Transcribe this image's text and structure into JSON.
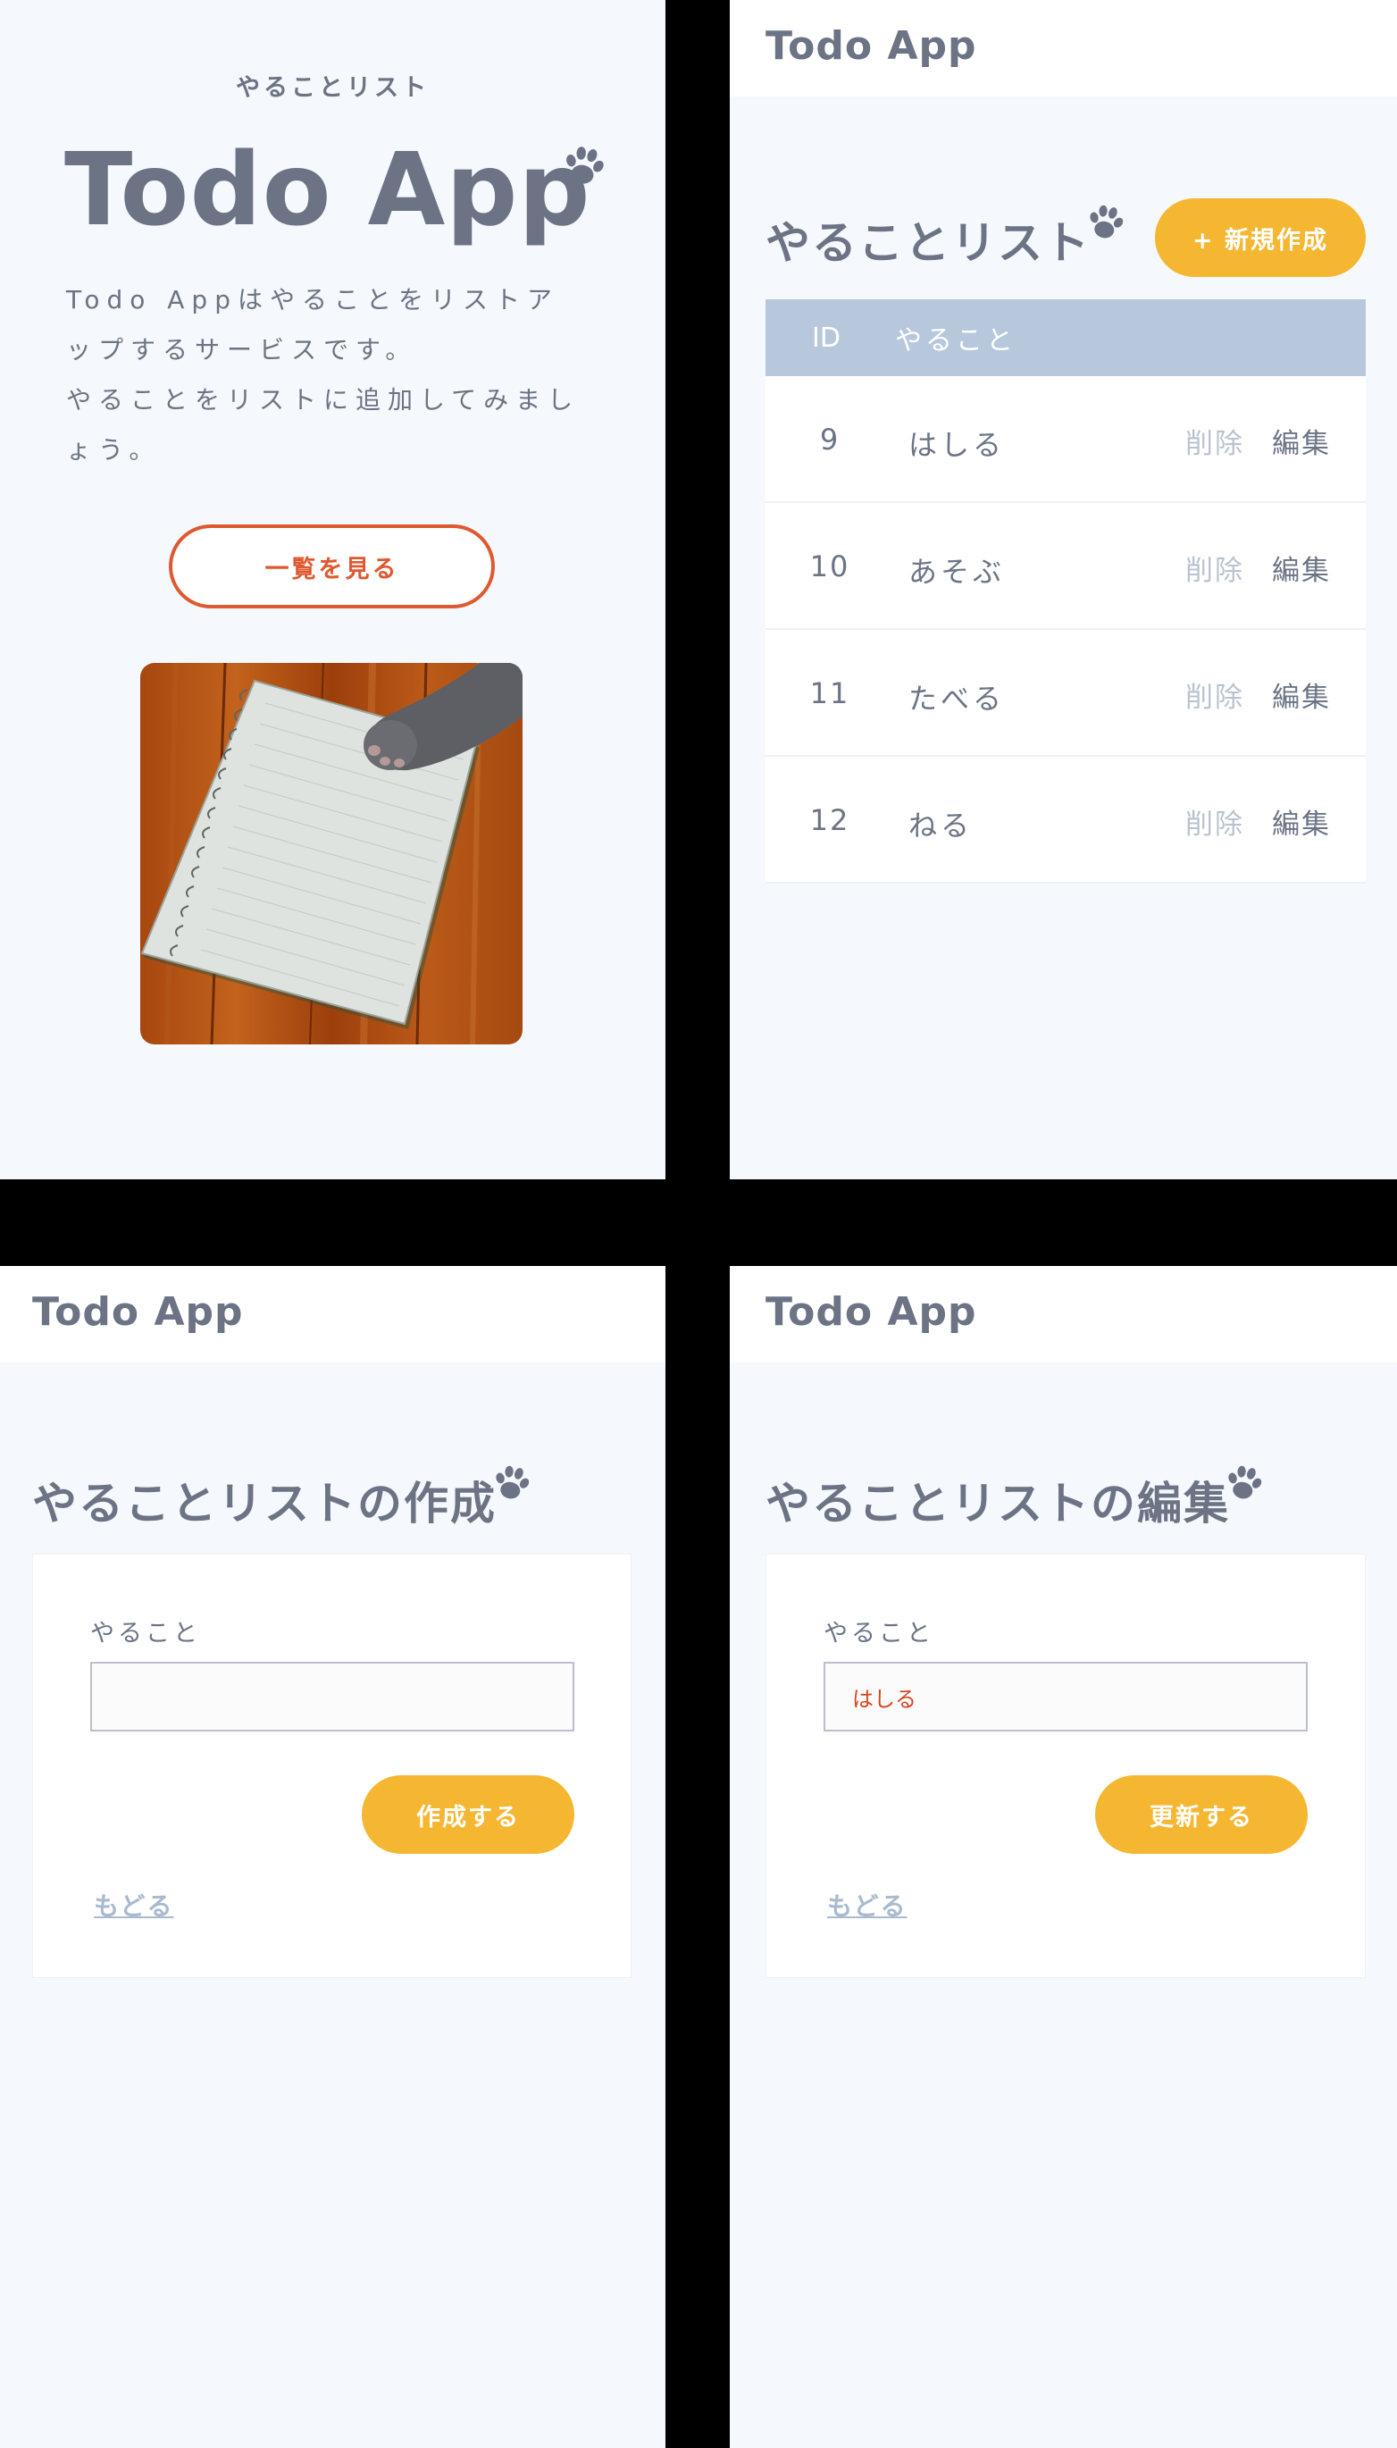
{
  "top_page": {
    "subtitle": "やることリスト",
    "title": "Todo App",
    "description_line1": "Todo Appはやることをリストア",
    "description_line2": "ップするサービスです。",
    "description_line3": "やることをリストに追加してみまし",
    "description_line4": "ょう。",
    "view_list_button": "一覧を見る"
  },
  "list_page": {
    "header_title": "Todo App",
    "page_title": "やることリスト",
    "new_button": "+ 新規作成",
    "table": {
      "columns": [
        "ID",
        "やること"
      ],
      "rows": [
        {
          "id": "9",
          "todo": "はしる",
          "delete": "削除",
          "edit": "編集"
        },
        {
          "id": "10",
          "todo": "あそぶ",
          "delete": "削除",
          "edit": "編集"
        },
        {
          "id": "11",
          "todo": "たべる",
          "delete": "削除",
          "edit": "編集"
        },
        {
          "id": "12",
          "todo": "ねる",
          "delete": "削除",
          "edit": "編集"
        }
      ]
    }
  },
  "create_page": {
    "header_title": "Todo App",
    "page_title": "やることリストの作成",
    "field_label": "やること",
    "field_value": "",
    "submit_button": "作成する",
    "back_link": "もどる"
  },
  "edit_page": {
    "header_title": "Todo App",
    "page_title": "やることリストの編集",
    "field_label": "やること",
    "field_value": "はしる",
    "submit_button": "更新する",
    "back_link": "もどる"
  },
  "colors": {
    "background": "#f5f8fc",
    "text": "#6b7384",
    "accent_yellow": "#f5b731",
    "accent_orange": "#e0582f",
    "table_header": "#b8c8dc",
    "muted": "#b9c3cf"
  },
  "icons": [
    "paw-icon",
    "cat-notebook-photo"
  ]
}
